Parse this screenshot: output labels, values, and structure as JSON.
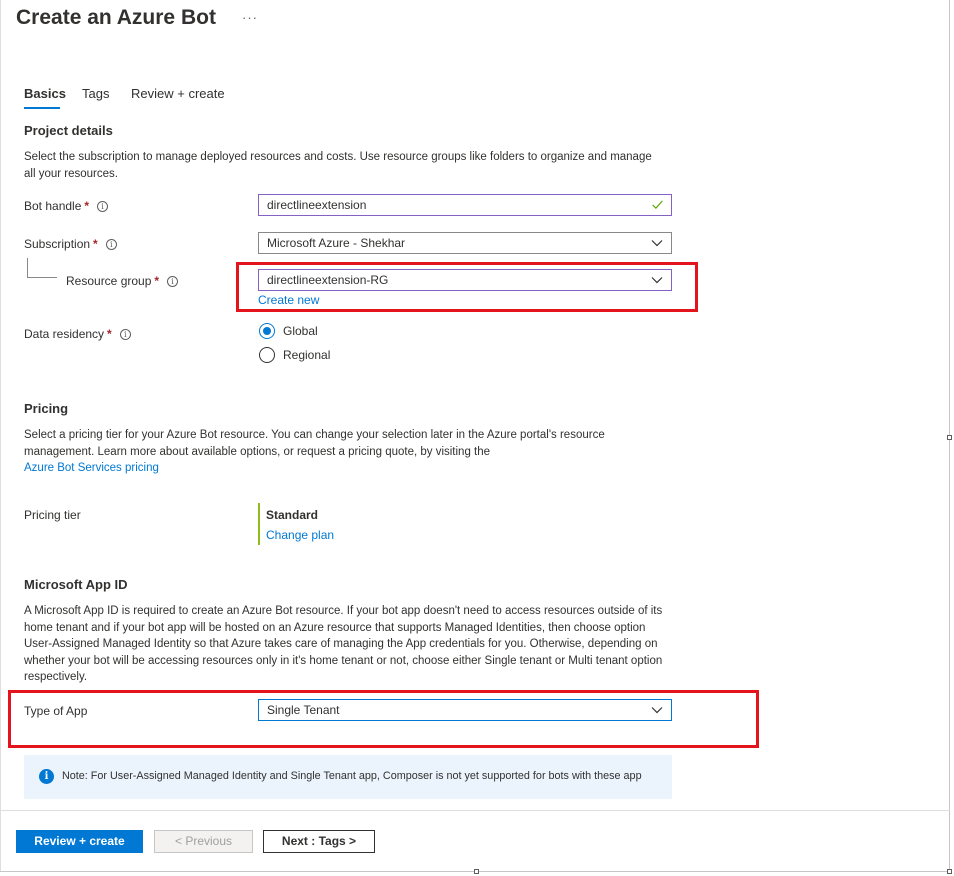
{
  "header": {
    "title": "Create an Azure Bot",
    "more": "···"
  },
  "tabs": [
    {
      "label": "Basics",
      "active": true
    },
    {
      "label": "Tags",
      "active": false
    },
    {
      "label": "Review + create",
      "active": false
    }
  ],
  "project": {
    "heading": "Project details",
    "description": "Select the subscription to manage deployed resources and costs. Use resource groups like folders to organize and manage all your resources."
  },
  "fields": {
    "bot_handle": {
      "label": "Bot handle",
      "required": "*",
      "value": "directlineextension"
    },
    "subscription": {
      "label": "Subscription",
      "required": "*",
      "value": "Microsoft Azure - Shekhar"
    },
    "resource_group": {
      "label": "Resource group",
      "required": "*",
      "value": "directlineextension-RG",
      "create_new": "Create new"
    },
    "data_residency": {
      "label": "Data residency",
      "required": "*",
      "options": [
        {
          "label": "Global",
          "selected": true
        },
        {
          "label": "Regional",
          "selected": false
        }
      ]
    }
  },
  "pricing": {
    "heading": "Pricing",
    "description": "Select a pricing tier for your Azure Bot resource. You can change your selection later in the Azure portal's resource management. Learn more about available options, or request a pricing quote, by visiting the",
    "link": "Azure Bot Services pricing",
    "tier_label": "Pricing tier",
    "tier_value": "Standard",
    "change_plan": "Change plan"
  },
  "app_id": {
    "heading": "Microsoft App ID",
    "description": "A Microsoft App ID is required to create an Azure Bot resource. If your bot app doesn't need to access resources outside of its home tenant and if your bot app will be hosted on an Azure resource that supports Managed Identities, then choose option User-Assigned Managed Identity so that Azure takes care of managing the App credentials for you. Otherwise, depending on whether your bot will be accessing resources only in it's home tenant or not, choose either Single tenant or Multi tenant option respectively.",
    "type_label": "Type of App",
    "type_value": "Single Tenant"
  },
  "note": {
    "icon": "info-icon",
    "text": "Note: For User-Assigned Managed Identity and Single Tenant app, Composer is not yet supported for bots with these app"
  },
  "footer": {
    "review_create": "Review + create",
    "previous": "< Previous",
    "next": "Next : Tags >"
  },
  "colors": {
    "accent": "#0078d4",
    "highlight": "#e3141b",
    "tier_bar": "#8cbd18"
  }
}
